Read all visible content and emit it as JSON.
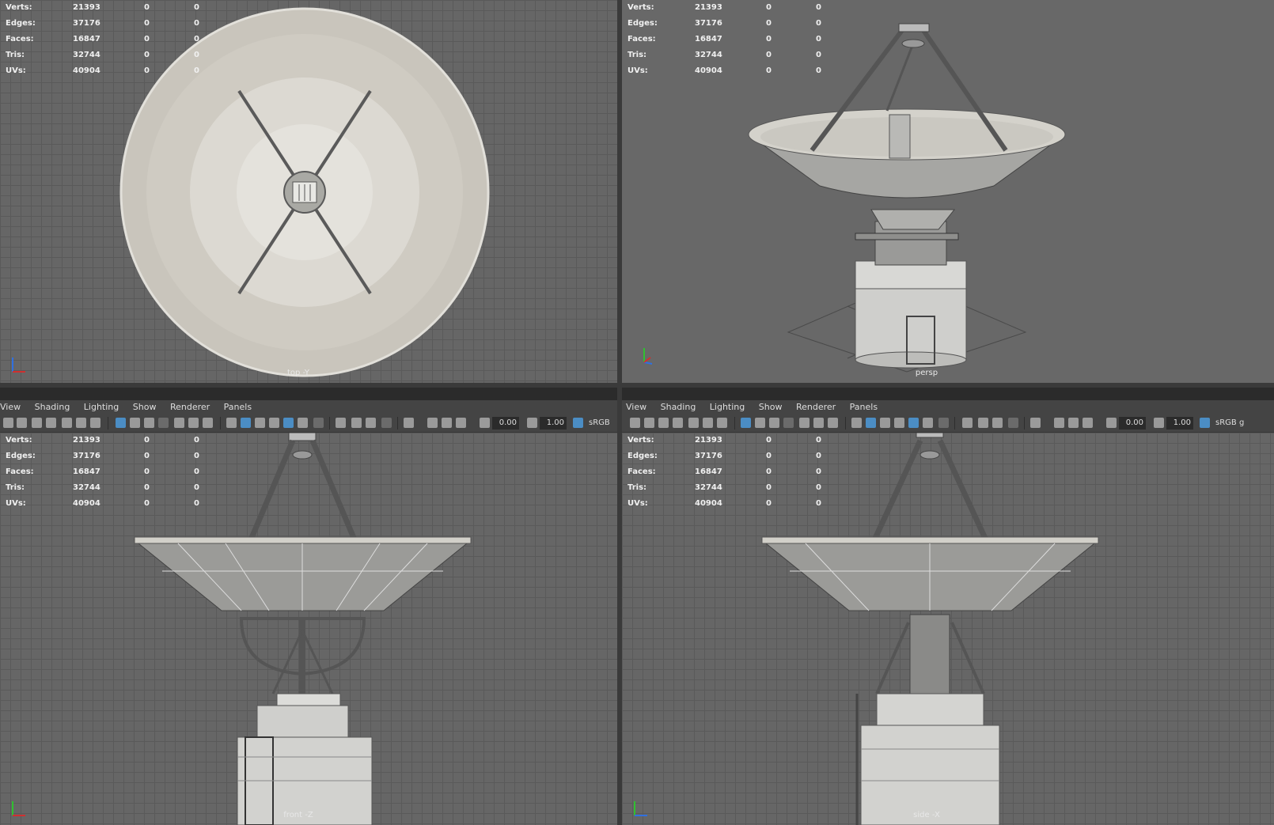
{
  "menu": [
    "View",
    "Shading",
    "Lighting",
    "Show",
    "Renderer",
    "Panels"
  ],
  "stats": [
    {
      "label": "Verts:",
      "v1": "21393",
      "v2": "0",
      "v3": "0"
    },
    {
      "label": "Edges:",
      "v1": "37176",
      "v2": "0",
      "v3": "0"
    },
    {
      "label": "Faces:",
      "v1": "16847",
      "v2": "0",
      "v3": "0"
    },
    {
      "label": "Tris:",
      "v1": "32744",
      "v2": "0",
      "v3": "0"
    },
    {
      "label": "UVs:",
      "v1": "40904",
      "v2": "0",
      "v3": "0"
    }
  ],
  "viewports": {
    "top": {
      "label": "top -Y"
    },
    "persp": {
      "label": "persp"
    },
    "front": {
      "label": "front -Z"
    },
    "side": {
      "label": "side -X"
    }
  },
  "toolbar": {
    "exposure": "0.00",
    "gamma": "1.00",
    "colorspace": "sRGB g"
  },
  "axis": {
    "y": "y",
    "z": "z",
    "x": "x"
  },
  "colors": {
    "accent": "#4b8dc4",
    "grid": "#5a5a5a",
    "viewport_bg": "#666666",
    "x_axis": "#d03030",
    "y_axis": "#30c030",
    "z_axis": "#3070e0"
  }
}
